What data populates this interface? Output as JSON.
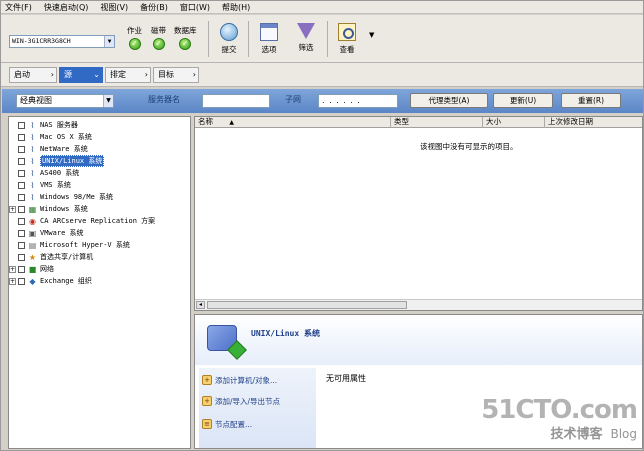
{
  "menubar": {
    "items": [
      "文件(F)",
      "快速启动(Q)",
      "视图(V)",
      "备份(B)",
      "窗口(W)",
      "帮助(H)"
    ]
  },
  "toolbar": {
    "server": "WIN-3G1CRR3G8CH",
    "status": [
      {
        "label": "作业",
        "state": "ok"
      },
      {
        "label": "磁带",
        "state": "ok"
      },
      {
        "label": "数据库",
        "state": "ok"
      }
    ],
    "buttons": {
      "submit": "提交",
      "options": "选项",
      "filter": "筛选",
      "view": "查看"
    }
  },
  "navbar": {
    "crumbs": [
      "启动",
      "源",
      "排定",
      "目标"
    ]
  },
  "filterbar": {
    "view_select": "经典视图",
    "server_name_label": "服务器名",
    "server_name_value": "",
    "subnet_label": "子网",
    "subnet_value": ". . . . . .",
    "agent_type_button": "代理类型(A)",
    "update_button": "更新(U)",
    "reset_button": "重置(R)"
  },
  "tree": {
    "nodes": [
      {
        "label": "NAS 服务器",
        "expand": false,
        "icon": "nas-icon"
      },
      {
        "label": "Mac OS X 系统",
        "expand": false,
        "icon": "mac-icon"
      },
      {
        "label": "NetWare 系统",
        "expand": false,
        "icon": "netware-icon"
      },
      {
        "label": "UNIX/Linux 系统",
        "expand": false,
        "icon": "unix-icon",
        "selected": true
      },
      {
        "label": "AS400 系统",
        "expand": false,
        "icon": "as400-icon"
      },
      {
        "label": "VMS 系统",
        "expand": false,
        "icon": "vms-icon"
      },
      {
        "label": "Windows 98/Me 系统",
        "expand": false,
        "icon": "win98-icon"
      },
      {
        "label": "Windows 系统",
        "expand": true,
        "icon": "windows-icon"
      },
      {
        "label": "CA ARCserve Replication 方案",
        "expand": false,
        "icon": "replication-icon"
      },
      {
        "label": "VMware 系统",
        "expand": false,
        "icon": "vmware-icon"
      },
      {
        "label": "Microsoft Hyper-V 系统",
        "expand": false,
        "icon": "hyperv-icon"
      },
      {
        "label": "首选共享/计算机",
        "expand": false,
        "icon": "share-icon"
      },
      {
        "label": "网络",
        "expand": true,
        "icon": "network-icon"
      },
      {
        "label": "Exchange 组织",
        "expand": true,
        "icon": "exchange-icon"
      }
    ]
  },
  "listpane": {
    "columns": [
      "名称",
      "类型",
      "大小",
      "上次修改日期"
    ],
    "empty_text": "该视图中没有可显示的项目。"
  },
  "proppane": {
    "title": "UNIX/Linux 系统",
    "tasks": [
      "添加计算机/对象...",
      "添加/导入/导出节点",
      "节点配置..."
    ],
    "no_props": "无可用属性"
  },
  "watermark": {
    "logo": "51CTO.com",
    "sub": "技术博客",
    "blog": "Blog"
  }
}
